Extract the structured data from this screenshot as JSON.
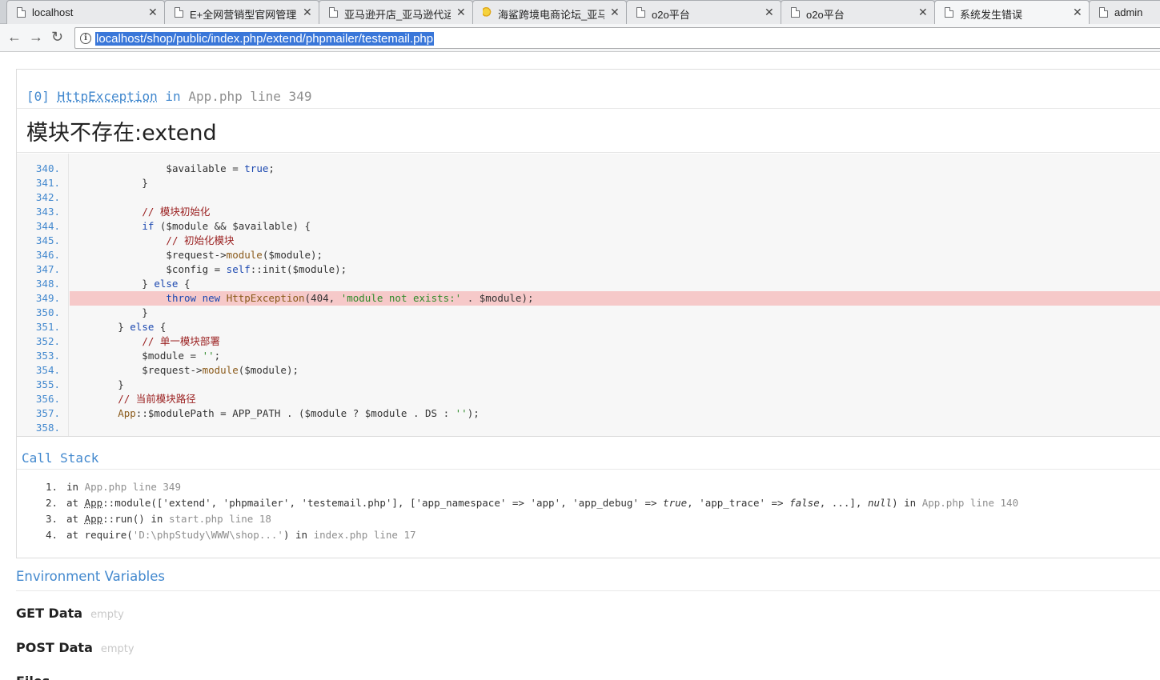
{
  "browser": {
    "tabs": [
      {
        "title": "localhost",
        "active": false,
        "special_icon": false
      },
      {
        "title": "E+全网营销型官网管理后",
        "active": false,
        "special_icon": false
      },
      {
        "title": "亚马逊开店_亚马逊代运营",
        "active": false,
        "special_icon": false
      },
      {
        "title": "海鲨跨境电商论坛_亚马逊",
        "active": false,
        "special_icon": true
      },
      {
        "title": "o2o平台",
        "active": false,
        "special_icon": false
      },
      {
        "title": "o2o平台",
        "active": false,
        "special_icon": false
      },
      {
        "title": "系统发生错误",
        "active": true,
        "special_icon": false
      },
      {
        "title": "admin",
        "active": false,
        "special_icon": false
      }
    ],
    "close_glyph": "✕",
    "back_glyph": "←",
    "forward_glyph": "→",
    "reload_glyph": "↻",
    "info_glyph": "i",
    "url": "localhost/shop/public/index.php/extend/phpmailer/testemail.php"
  },
  "exception": {
    "index": "[0]",
    "class_name": "HttpException",
    "in_word": "in",
    "file": "App.php line 349",
    "message": "模块不存在:extend"
  },
  "source": {
    "highlight_line": "349.",
    "lines": [
      {
        "no": "340.",
        "html": "                <span class=\"tok-v\">$available</span> = <span class=\"tok-kw\">true</span>;"
      },
      {
        "no": "341.",
        "html": "            }"
      },
      {
        "no": "342.",
        "html": ""
      },
      {
        "no": "343.",
        "html": "            <span class=\"tok-cmt\">// 模块初始化</span>"
      },
      {
        "no": "344.",
        "html": "            <span class=\"tok-kw\">if</span> ($module && $available) {"
      },
      {
        "no": "345.",
        "html": "                <span class=\"tok-cmt\">// 初始化模块</span>"
      },
      {
        "no": "346.",
        "html": "                $request-><span class=\"tok-fn\">module</span>($module);"
      },
      {
        "no": "347.",
        "html": "                $config = <span class=\"tok-kw\">self</span>::init($module);"
      },
      {
        "no": "348.",
        "html": "            } <span class=\"tok-kw\">else</span> {"
      },
      {
        "no": "349.",
        "html": "                <span class=\"tok-kw\">throw new</span> <span class=\"tok-fn\">HttpException</span>(404, <span class=\"tok-str\">'module not exists:'</span> . $module);"
      },
      {
        "no": "350.",
        "html": "            }"
      },
      {
        "no": "351.",
        "html": "        } <span class=\"tok-kw\">else</span> {"
      },
      {
        "no": "352.",
        "html": "            <span class=\"tok-cmt\">// 单一模块部署</span>"
      },
      {
        "no": "353.",
        "html": "            $module = <span class=\"tok-str\">''</span>;"
      },
      {
        "no": "354.",
        "html": "            $request-><span class=\"tok-fn\">module</span>($module);"
      },
      {
        "no": "355.",
        "html": "        }"
      },
      {
        "no": "356.",
        "html": "        <span class=\"tok-cmt\">// 当前模块路径</span>"
      },
      {
        "no": "357.",
        "html": "        <span class=\"tok-fn\">App</span>::$modulePath = APP_PATH . ($module ? $module . DS : <span class=\"tok-str\">''</span>);"
      },
      {
        "no": "358.",
        "html": ""
      }
    ]
  },
  "call_stack": {
    "title": "Call Stack",
    "items": [
      {
        "num": "1.",
        "html": "in <span class=\"loc\">App.php line 349</span>"
      },
      {
        "num": "2.",
        "html": "at <span class=\"cls\">App</span>::module(['extend', 'phpmailer', 'testemail.php'], ['app_namespace' => 'app', 'app_debug' => <span class=\"lit\">true</span>, 'app_trace' => <span class=\"lit\">false</span>, ...], <span class=\"lit\">null</span>) in <span class=\"loc\">App.php line 140</span>"
      },
      {
        "num": "3.",
        "html": "at <span class=\"cls\">App</span>::run() in <span class=\"loc\">start.php line 18</span>"
      },
      {
        "num": "4.",
        "html": "at require(<span class=\"loc\">'D:\\phpStudy\\WWW\\shop...'</span>) in <span class=\"loc\">index.php line 17</span>"
      }
    ]
  },
  "environment": {
    "title": "Environment Variables",
    "sections": [
      {
        "label": "GET Data",
        "value": "empty"
      },
      {
        "label": "POST Data",
        "value": "empty"
      },
      {
        "label": "Files",
        "value": ""
      }
    ]
  },
  "colors": {
    "accent": "#4288ce",
    "highlight": "#f6c9c9",
    "selection": "#3a77d9"
  }
}
